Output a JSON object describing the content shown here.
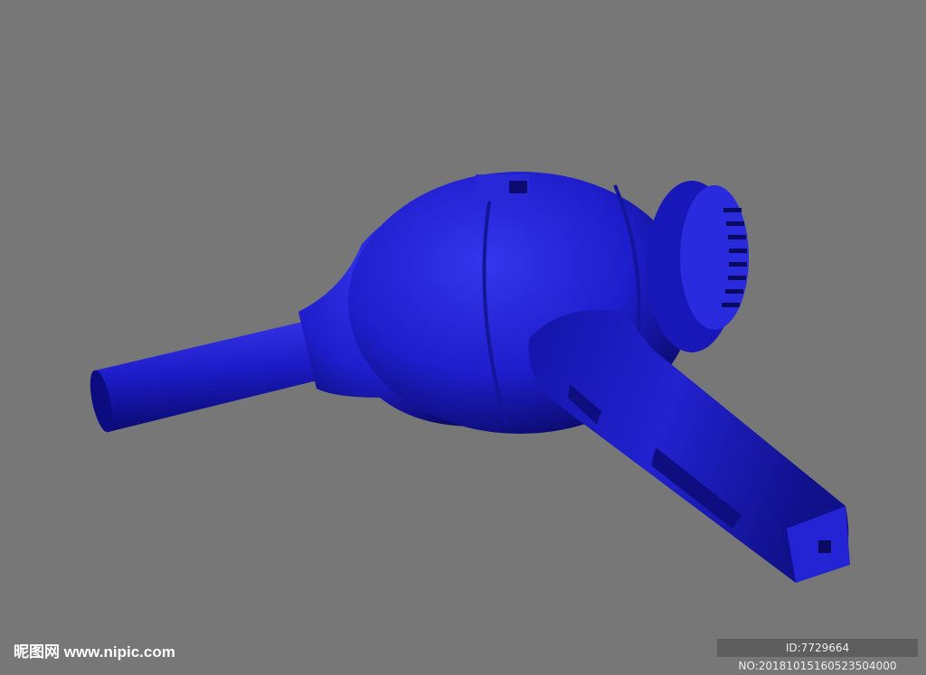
{
  "image": {
    "subject": "blue-hair-dryer-3d-render",
    "background_color": "#777777",
    "object_color": "#1e1ed0"
  },
  "watermark": {
    "site": "昵图网 www.nipic.com",
    "id_text": "ID:7729664 NO:20181015160523504000"
  }
}
